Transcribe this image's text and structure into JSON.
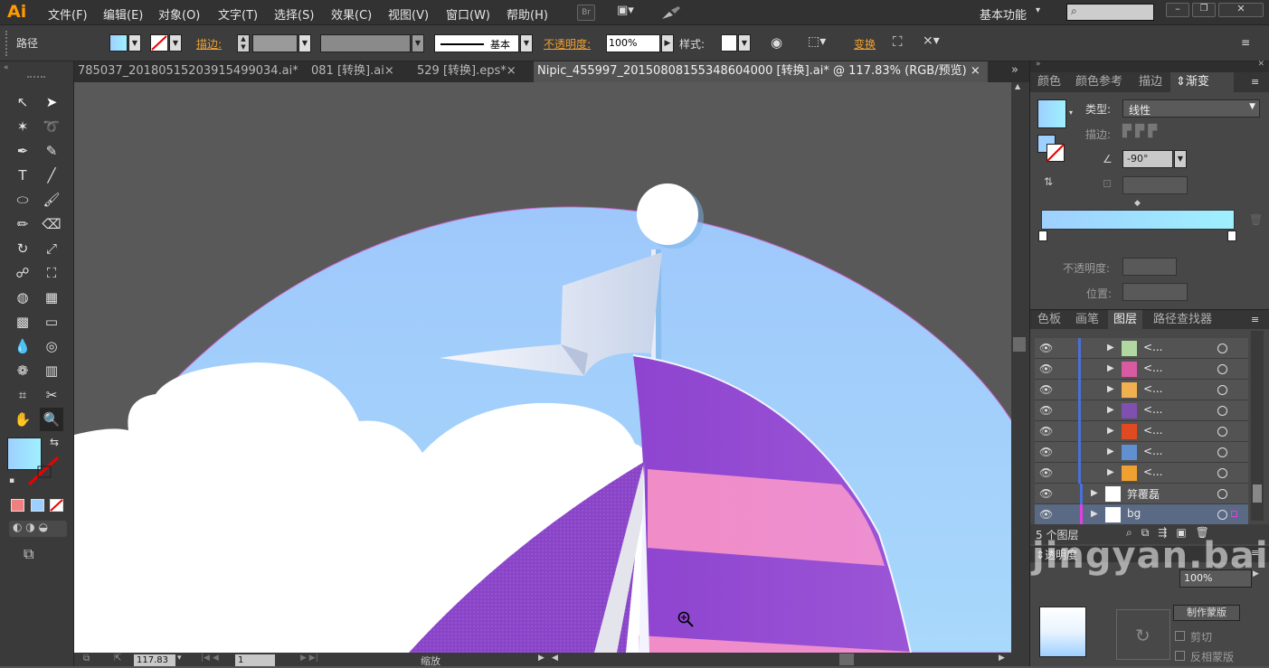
{
  "app": {
    "logo": "Ai"
  },
  "menu": [
    "文件(F)",
    "编辑(E)",
    "对象(O)",
    "文字(T)",
    "选择(S)",
    "效果(C)",
    "视图(V)",
    "窗口(W)",
    "帮助(H)"
  ],
  "workspace": {
    "label": "基本功能"
  },
  "menubar_icons": [
    "Br",
    "▣▾",
    "brush-icon"
  ],
  "control": {
    "object_type": "路径",
    "stroke_label": "描边:",
    "brush_label": "基本",
    "opacity_label": "不透明度:",
    "opacity_value": "100%",
    "style_label": "样式:",
    "transform_label": "变换"
  },
  "tabs": [
    {
      "label": "785037_20180515203915499034.ai*",
      "close": "×"
    },
    {
      "label": "081 [转换].ai",
      "close": "×"
    },
    {
      "label": "529 [转换].eps*",
      "close": "×"
    },
    {
      "label": "Nipic_455997_20150808155348604000 [转换].ai* @ 117.83% (RGB/预览)",
      "close": "×",
      "active": true
    }
  ],
  "tabs_overflow": "»",
  "status": {
    "zoom": "117.83",
    "page": "1",
    "mode": "缩放"
  },
  "gradient_panel": {
    "tabs": [
      "颜色",
      "颜色参考",
      "描边",
      "渐变"
    ],
    "active_tab": "渐变",
    "type_label": "类型:",
    "type_value": "线性",
    "stroke_label": "描边:",
    "angle_value": "-90°",
    "opacity_label": "不透明度:",
    "location_label": "位置:",
    "gradient_start": "#9ed0ff",
    "gradient_end": "#9ff0ff"
  },
  "layers_panel": {
    "tabs": [
      "色板",
      "画笔",
      "图层",
      "路径查找器"
    ],
    "active_tab": "图层",
    "rows": [
      {
        "name": "<...",
        "thumb": "person"
      },
      {
        "name": "<...",
        "thumb": "pink"
      },
      {
        "name": "<...",
        "thumb": "orange"
      },
      {
        "name": "<...",
        "thumb": "grape"
      },
      {
        "name": "<...",
        "thumb": "red"
      },
      {
        "name": "<...",
        "thumb": "kids"
      },
      {
        "name": "<...",
        "thumb": "fruit"
      },
      {
        "name": "笄覆磊",
        "thumb": "white",
        "layer": true
      },
      {
        "name": "bg",
        "thumb": "white",
        "layer": true,
        "selected": true
      }
    ],
    "count_label": "5 个图层"
  },
  "transparency_panel": {
    "title": "透明度",
    "value": "100%",
    "make_mask": "制作蒙版",
    "clip": "剪切",
    "invert": "反相蒙版"
  },
  "watermark": "jingyan.baidu"
}
